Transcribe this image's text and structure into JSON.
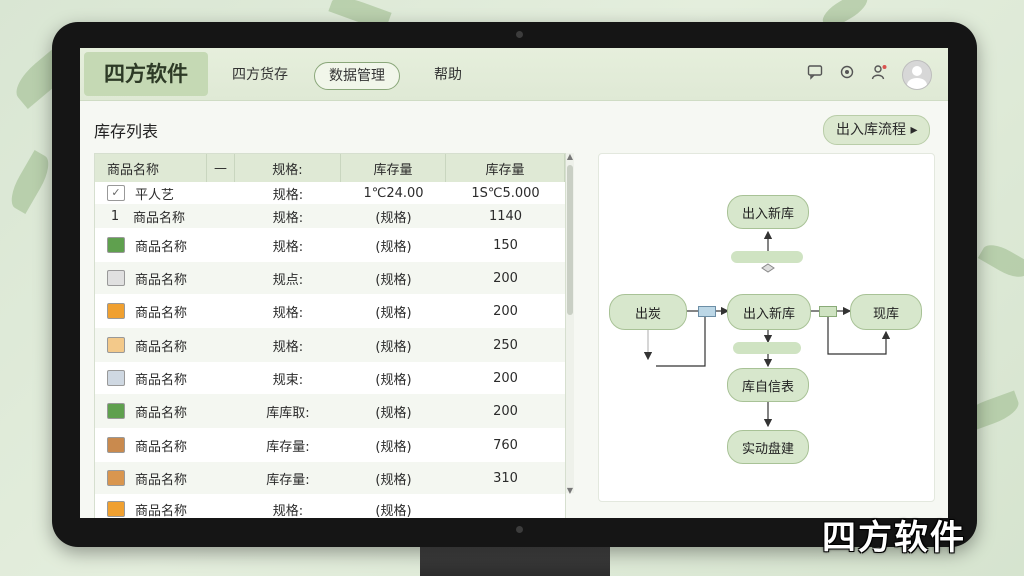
{
  "app": {
    "logo": "四方软件",
    "watermark": "四方软件"
  },
  "nav": [
    {
      "label": "四方货存"
    },
    {
      "label": "数据管理",
      "active": true
    },
    {
      "label": "帮助"
    }
  ],
  "header": {
    "section_title": "库存列表",
    "flow_button": "出入库流程 ▸"
  },
  "table": {
    "headers": [
      "商品名称",
      "—",
      "规格:",
      "库存量",
      "库存量"
    ],
    "rows": [
      {
        "icon": "check-icon",
        "icon_color": "#ffffff",
        "num": "",
        "name": "平人艺",
        "spec": "规格:",
        "stock": "1℃24.00",
        "qty": "1S℃5.000"
      },
      {
        "icon": "",
        "icon_color": "",
        "num": "1",
        "name": "商品名称",
        "spec": "规格:",
        "stock": "(规格)",
        "qty": "1140"
      },
      {
        "icon": "green-box-icon",
        "icon_color": "#5fa04e",
        "num": "",
        "name": "商品名称",
        "spec": "规格:",
        "stock": "(规格)",
        "qty": "150"
      },
      {
        "icon": "gray-box-icon",
        "icon_color": "#e0e0e0",
        "num": "",
        "name": "商品名称",
        "spec": "规点:",
        "stock": "(规格)",
        "qty": "200"
      },
      {
        "icon": "orange-box-icon",
        "icon_color": "#f0a030",
        "num": "",
        "name": "商品名称",
        "spec": "规格:",
        "stock": "(规格)",
        "qty": "200"
      },
      {
        "icon": "open-box-icon",
        "icon_color": "#f3c98a",
        "num": "",
        "name": "商品名称",
        "spec": "规格:",
        "stock": "(规格)",
        "qty": "250"
      },
      {
        "icon": "boxes-icon",
        "icon_color": "#cfd8e2",
        "num": "",
        "name": "商品名称",
        "spec": "规束:",
        "stock": "(规格)",
        "qty": "200"
      },
      {
        "icon": "green-box-icon",
        "icon_color": "#5fa04e",
        "num": "",
        "name": "商品名称",
        "spec": "库库取:",
        "stock": "(规格)",
        "qty": "200"
      },
      {
        "icon": "brown-box-icon",
        "icon_color": "#c98a4e",
        "num": "",
        "name": "商品名称",
        "spec": "库存量:",
        "stock": "(规格)",
        "qty": "760"
      },
      {
        "icon": "brown-box-icon",
        "icon_color": "#d9964f",
        "num": "",
        "name": "商品名称",
        "spec": "库存量:",
        "stock": "(规格)",
        "qty": "310"
      },
      {
        "icon": "orange-box-icon",
        "icon_color": "#f0a030",
        "num": "",
        "name": "商品名称",
        "spec": "规格:",
        "stock": "(规格)",
        "qty": ""
      }
    ]
  },
  "flow": {
    "nodes": {
      "top": "出入新库",
      "left": "出炭",
      "center": "出入新库",
      "right": "现库",
      "mid": "库自信表",
      "bottom": "实动盘建"
    }
  },
  "colors": {
    "accent": "#dbe8cf",
    "node": "#d7e7cc",
    "header": "#dfe9d5"
  }
}
